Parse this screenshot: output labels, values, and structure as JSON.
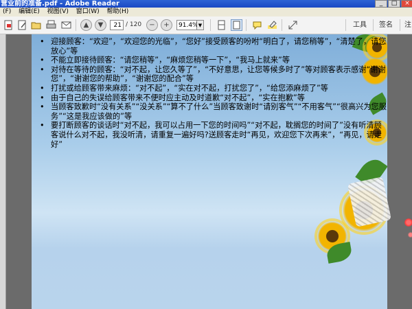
{
  "window": {
    "title": "营业前的准备.pdf - Adobe Reader"
  },
  "menubar": {
    "items": [
      {
        "label": "(F)"
      },
      {
        "label": "编辑(E)"
      },
      {
        "label": "视图(V)"
      },
      {
        "label": "窗口(W)"
      },
      {
        "label": "帮助(H)"
      }
    ]
  },
  "toolbar": {
    "page_current": "21",
    "page_total": "/ 120",
    "zoom": "91.4%",
    "tools_label": "工具",
    "sign_label": "签名",
    "comment_label": "注"
  },
  "content": {
    "items": [
      {
        "text": "迎接顾客：“欢迎”，“欢迎您的光临”，“您好”接受顾客的吩咐“明白了，请您稍等”，“清楚了，请您放心”等"
      },
      {
        "text": "不能立即接待顾客：“请您稍等”，“麻烦您稍等一下”，“我马上就来”等"
      },
      {
        "text": "对待在等待的顾客：“对不起，让您久等了”，“不好意思，让您等候多时了”等对顾客表示感谢“谢谢您”，“谢谢您的帮助”，“谢谢您的配合”等"
      },
      {
        "text": "打扰或给顾客带来麻烦：“对不起”，“实在对不起，打扰您了”，“给您添麻烦了”等"
      },
      {
        "text": "由于自己的失误给顾客带来不便时应主动及时道歉“对不起”，“实在抱歉”等"
      },
      {
        "text": "当顾客致歉时“没有关系”“没关系”“算不了什么”当顾客致谢时“请别客气”“不用客气”“很高兴为您服务”“这是我应该做的”等"
      },
      {
        "text": "要打断顾客的谈话时“对不起，我可以占用一下您的时间吗”“对不起，耽搁您的时间了”没有听清顾客说什么对不起，我没听清，请重复一遍好吗?送顾客走时“再见，欢迎您下次再来”，“再见，请走好”"
      }
    ]
  },
  "colors": {
    "titlebar": "#1a49c4",
    "page_sky": "#a9cdea",
    "sunflower": "#f2b400"
  }
}
